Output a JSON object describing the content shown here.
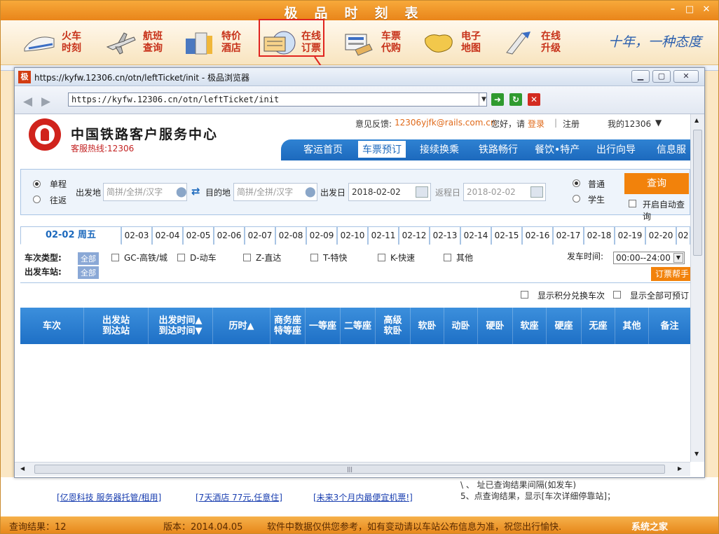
{
  "app": {
    "title": "极品时刻表",
    "slogan": "十年，一种态度",
    "toolbar": [
      {
        "label1": "火车",
        "label2": "时刻",
        "icon": "train-icon"
      },
      {
        "label1": "航班",
        "label2": "查询",
        "icon": "airplane-icon"
      },
      {
        "label1": "特价",
        "label2": "酒店",
        "icon": "hotel-icon"
      },
      {
        "label1": "在线",
        "label2": "订票",
        "icon": "online-ticket-icon"
      },
      {
        "label1": "车票",
        "label2": "代购",
        "icon": "ticket-agent-icon"
      },
      {
        "label1": "电子",
        "label2": "地图",
        "icon": "map-icon"
      },
      {
        "label1": "在线",
        "label2": "升级",
        "icon": "upgrade-icon"
      }
    ],
    "bg_links": [
      "[亿恩科技 服务器托管/租用]",
      "[7天酒店 77元,任意住]",
      "[未来3个月内最便宜机票!]"
    ],
    "bg_hint1": "\\ 、 址已查询结果间隔(如发车)",
    "bg_hint2": "5、点查询结果，显示[车次详细停靠站]；",
    "status": {
      "result": "查询结果：12",
      "version": "版本：2014.04.05",
      "notice": "软件中数据仅供您参考，如有变动请以车站公布信息为准，祝您出行愉快.",
      "watermark": "系统之家"
    }
  },
  "browser": {
    "title": "https://kyfw.12306.cn/otn/leftTicket/init - 极品浏览器",
    "favicon": "极",
    "url": "https://kyfw.12306.cn/otn/leftTicket/init"
  },
  "site": {
    "name": "中国铁路客户服务中心",
    "hotline": "客服热线:12306",
    "feedback_label": "意见反馈:",
    "feedback_email": "12306yjfk@rails.com.cn",
    "greeting": "您好，请",
    "login": "登录",
    "sep": "|",
    "register": "注册",
    "my12306": "我的12306",
    "nav": [
      "客运首页",
      "车票预订",
      "接续换乘",
      "铁路畅行",
      "餐饮•特产",
      "出行向导",
      "信息服"
    ]
  },
  "query": {
    "oneway": "单程",
    "roundtrip": "往返",
    "from_label": "出发地",
    "from_placeholder": "简拼/全拼/汉字",
    "to_label": "目的地",
    "to_placeholder": "简拼/全拼/汉字",
    "depart_label": "出发日",
    "depart_date": "2018-02-02",
    "return_label": "返程日",
    "return_date": "2018-02-02",
    "normal": "普通",
    "student": "学生",
    "search": "查询",
    "auto_query": "开启自动查询"
  },
  "dates": [
    "02-02 周五",
    "02-03",
    "02-04",
    "02-05",
    "02-06",
    "02-07",
    "02-08",
    "02-09",
    "02-10",
    "02-11",
    "02-12",
    "02-13",
    "02-14",
    "02-15",
    "02-16",
    "02-17",
    "02-18",
    "02-19",
    "02-20",
    "02"
  ],
  "filters": {
    "type_label": "车次类型:",
    "station_label": "出发车站:",
    "all": "全部",
    "types": [
      "GC-高铁/城",
      "D-动车",
      "Z-直达",
      "T-特快",
      "K-快速",
      "其他"
    ],
    "time_label": "发车时间:",
    "time_value": "00:00--24:00",
    "help": "订票帮手",
    "show_points": "显示积分兑换车次",
    "show_all": "显示全部可预订"
  },
  "table_headers": [
    "车次",
    "出发站\n到达站",
    "出发时间▲\n到达时间▼",
    "历时▲",
    "商务座\n特等座",
    "一等座",
    "二等座",
    "高级\n软卧",
    "软卧",
    "动卧",
    "硬卧",
    "软座",
    "硬座",
    "无座",
    "其他",
    "备注"
  ]
}
